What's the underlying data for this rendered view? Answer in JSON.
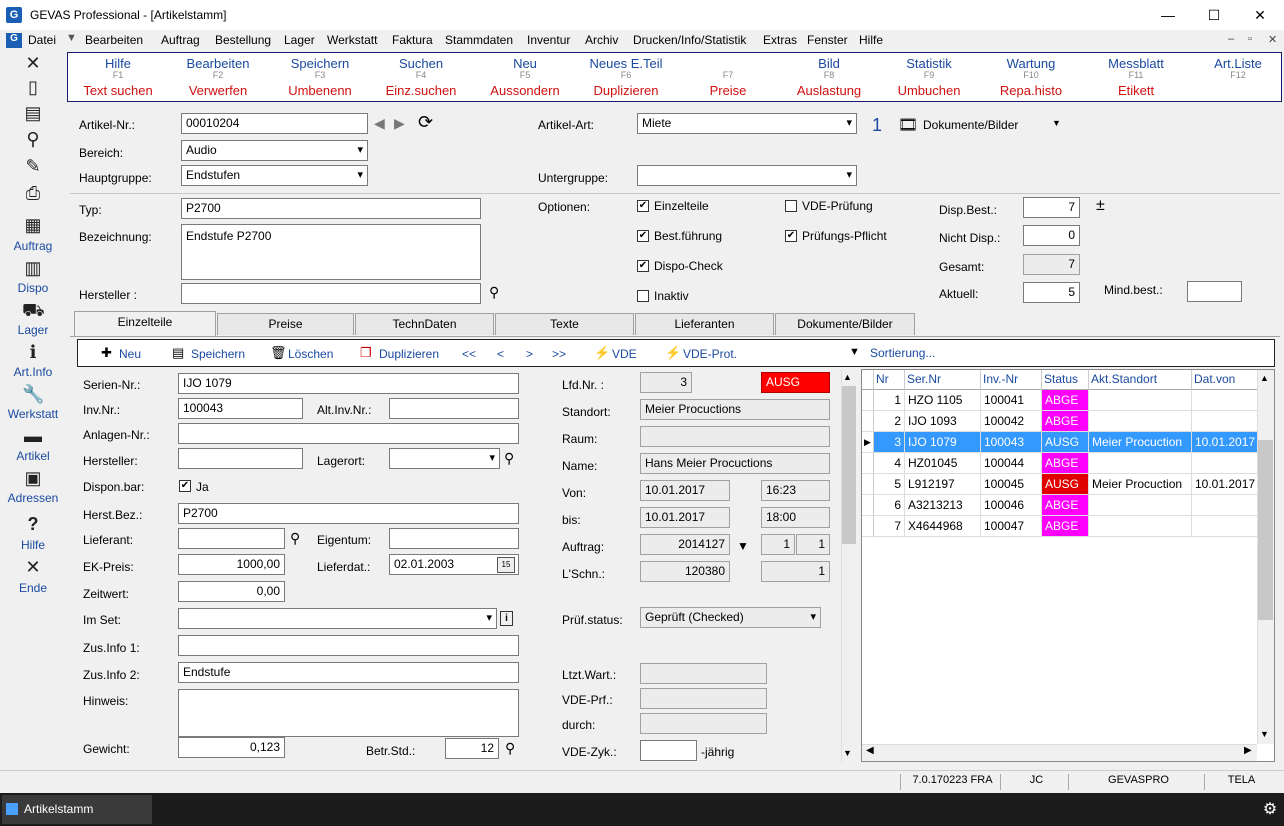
{
  "window": {
    "title": "GEVAS Professional - [Artikelstamm]",
    "app_icon": "G",
    "min": "—",
    "max": "☐",
    "close": "✕"
  },
  "menu": [
    "Datei",
    "Bearbeiten",
    "Auftrag",
    "Bestellung",
    "Lager",
    "Werkstatt",
    "Faktura",
    "Stammdaten",
    "Inventur",
    "Archiv",
    "Drucken/Info/Statistik",
    "Extras",
    "Fenster",
    "Hilfe"
  ],
  "toolbar": {
    "auftrag": "Auftrag",
    "dispo": "Dispo",
    "lager": "Lager",
    "artinfo": "Art.Info",
    "werkstatt": "Werkstatt",
    "artikel": "Artikel",
    "adressen": "Adressen",
    "hilfe": "Hilfe",
    "ende": "Ende"
  },
  "fkeys": [
    {
      "top": "Hilfe",
      "key": "F1",
      "bottom": "Text suchen"
    },
    {
      "top": "Bearbeiten",
      "key": "F2",
      "bottom": "Verwerfen"
    },
    {
      "top": "Speichern",
      "key": "F3",
      "bottom": "Umbenenn"
    },
    {
      "top": "Suchen",
      "key": "F4",
      "bottom": "Einz.suchen"
    },
    {
      "top": "Neu",
      "key": "F5",
      "bottom": "Aussondern"
    },
    {
      "top": "Neues E.Teil",
      "key": "F6",
      "bottom": "Duplizieren"
    },
    {
      "top": "",
      "key": "F7",
      "bottom": "Preise"
    },
    {
      "top": "Bild",
      "key": "F8",
      "bottom": "Auslastung"
    },
    {
      "top": "Statistik",
      "key": "F9",
      "bottom": "Umbuchen"
    },
    {
      "top": "Wartung",
      "key": "F10",
      "bottom": "Repa.histo"
    },
    {
      "top": "Messblatt",
      "key": "F11",
      "bottom": "Etikett"
    },
    {
      "top": "Art.Liste",
      "key": "F12",
      "bottom": ""
    }
  ],
  "head": {
    "artnr_label": "Artikel-Nr.:",
    "artnr": "00010204",
    "bereich_label": "Bereich:",
    "bereich": "Audio",
    "hauptgruppe_label": "Hauptgruppe:",
    "hauptgruppe": "Endstufen",
    "artart_label": "Artikel-Art:",
    "artart": "Miete",
    "count": "1",
    "dokumente": "Dokumente/Bilder",
    "untergruppe_label": "Untergruppe:",
    "untergruppe": ""
  },
  "detail": {
    "typ_label": "Typ:",
    "typ": "P2700",
    "bez_label": "Bezeichnung:",
    "bez": "Endstufe P2700",
    "hersteller_label": "Hersteller :",
    "hersteller": "",
    "optionen_label": "Optionen:",
    "opts": {
      "einzelteile": "Einzelteile",
      "bestfuehrung": "Best.führung",
      "dispocheck": "Dispo-Check",
      "inaktiv": "Inaktiv",
      "vde": "VDE-Prüfung",
      "pflicht": "Prüfungs-Pflicht"
    },
    "dispbest_label": "Disp.Best.:",
    "dispbest": "7",
    "pm": "±",
    "nichtdisp_label": "Nicht Disp.:",
    "nichtdisp": "0",
    "gesamt_label": "Gesamt:",
    "gesamt": "7",
    "aktuell_label": "Aktuell:",
    "aktuell": "5",
    "mindbest_label": "Mind.best.:",
    "mindbest": ""
  },
  "tabs": [
    "Einzelteile",
    "Preise",
    "TechnDaten",
    "Texte",
    "Lieferanten",
    "Dokumente/Bilder"
  ],
  "subtb": {
    "neu": "Neu",
    "speichern": "Speichern",
    "loeschen": "Löschen",
    "duplizieren": "Duplizieren",
    "first": "<<",
    "prev": "<",
    "next": ">",
    "last": ">>",
    "vde": "VDE",
    "vdeprot": "VDE-Prot.",
    "sort": "Sortierung..."
  },
  "form": {
    "seriennr_l": "Serien-Nr.:",
    "seriennr": "IJO 1079",
    "invnr_l": "Inv.Nr.:",
    "invnr": "100043",
    "altinv_l": "Alt.Inv.Nr.:",
    "altinv": "",
    "anlagen_l": "Anlagen-Nr.:",
    "anlagen": "",
    "herst_l": "Hersteller:",
    "herst": "",
    "lagerort_l": "Lagerort:",
    "lagerort": "",
    "dispon_l": "Dispon.bar:",
    "dispon": "Ja",
    "herstbez_l": "Herst.Bez.:",
    "herstbez": "P2700",
    "lieferant_l": "Lieferant:",
    "lieferant": "",
    "eigentum_l": "Eigentum:",
    "eigentum": "",
    "ekpreis_l": "EK-Preis:",
    "ekpreis": "1000,00",
    "lieferdat_l": "Lieferdat.:",
    "lieferdat": "02.01.2003",
    "cal": "15",
    "zeitwert_l": "Zeitwert:",
    "zeitwert": "0,00",
    "imset_l": "Im Set:",
    "imset": "",
    "zus1_l": "Zus.Info 1:",
    "zus1": "",
    "zus2_l": "Zus.Info 2:",
    "zus2": "Endstufe",
    "hinweis_l": "Hinweis:",
    "hinweis": "",
    "gewicht_l": "Gewicht:",
    "gewicht": "0,123",
    "betrstd_l": "Betr.Std.:",
    "betrstd": "12",
    "lfdnr_l": "Lfd.Nr. :",
    "lfdnr": "3",
    "status": "AUSG",
    "standort_l": "Standort:",
    "standort": "Meier Procuctions",
    "raum_l": "Raum:",
    "raum": "",
    "name_l": "Name:",
    "name": "Hans Meier Procuctions",
    "von_l": "Von:",
    "von_d": "10.01.2017",
    "von_t": "16:23",
    "bis_l": "bis:",
    "bis_d": "10.01.2017",
    "bis_t": "18:00",
    "auftrag_l": "Auftrag:",
    "auftrag": "2014127",
    "auftrag_a": "1",
    "auftrag_b": "1",
    "lschn_l": "L'Schn.:",
    "lschn": "120380",
    "lschn_b": "1",
    "pruef_l": "Prüf.status:",
    "pruef": "Geprüft (Checked)",
    "ltzt_l": "Ltzt.Wart.:",
    "ltzt": "",
    "vdeprf_l": "VDE-Prf.:",
    "vdeprf": "",
    "durch_l": "durch:",
    "durch": "",
    "vdezyk_l": "VDE-Zyk.:",
    "vdezyk": "",
    "jaehrig": "-jährig"
  },
  "grid": {
    "headers": [
      "Nr",
      "Ser.Nr",
      "Inv.-Nr",
      "Status",
      "Akt.Standort",
      "Dat.von"
    ],
    "rows": [
      [
        "1",
        "HZO 1105",
        "100041",
        "ABGE",
        "",
        ""
      ],
      [
        "2",
        "IJO 1093",
        "100042",
        "ABGE",
        "",
        ""
      ],
      [
        "3",
        "IJO 1079",
        "100043",
        "AUSG",
        "Meier Procuction",
        "10.01.2017"
      ],
      [
        "4",
        "HZ01045",
        "100044",
        "ABGE",
        "",
        ""
      ],
      [
        "5",
        "L912197",
        "100045",
        "AUSG",
        "Meier Procuction",
        "10.01.2017"
      ],
      [
        "6",
        "A3213213",
        "100046",
        "ABGE",
        "",
        ""
      ],
      [
        "7",
        "X4644968",
        "100047",
        "ABGE",
        "",
        ""
      ]
    ]
  },
  "status": {
    "version": "7.0.170223 FRA",
    "user": "JC",
    "db": "GEVASPRO",
    "site": "TELA"
  },
  "taskbar": {
    "item": "Artikelstamm"
  }
}
